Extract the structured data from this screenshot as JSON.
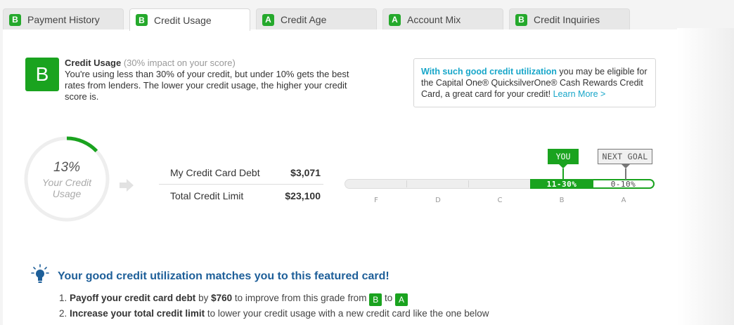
{
  "tabs": [
    {
      "grade": "B",
      "label": "Payment History"
    },
    {
      "grade": "B",
      "label": "Credit Usage"
    },
    {
      "grade": "A",
      "label": "Credit Age"
    },
    {
      "grade": "A",
      "label": "Account Mix"
    },
    {
      "grade": "B",
      "label": "Credit Inquiries"
    }
  ],
  "active_tab": "Credit Usage",
  "summary": {
    "grade": "B",
    "title": "Credit Usage",
    "impact": "(30% impact on your score)",
    "body": "You're using less than 30% of your credit, but under 10% gets the best rates from lenders. The lower your credit usage, the higher your credit score is."
  },
  "promo": {
    "highlight": "With such good credit utilization",
    "text": " you may be eligible for the Capital One® QuicksilverOne® Cash Rewards Credit Card, a great card for your credit! ",
    "link": "Learn More >"
  },
  "usage": {
    "percent_label": "13%",
    "percent_value": 13,
    "label": "Your Credit Usage"
  },
  "debt": {
    "rows": [
      {
        "label": "My Credit Card Debt",
        "value": "$3,071"
      },
      {
        "label": "Total Credit Limit",
        "value": "$23,100"
      }
    ]
  },
  "scale": {
    "you_flag": "YOU",
    "goal_flag": "NEXT GOAL",
    "you_range": "11-30%",
    "goal_range": "0-10%",
    "grades": [
      "F",
      "D",
      "C",
      "B",
      "A"
    ]
  },
  "featured": {
    "title": "Your good credit utilization matches you to this featured card!",
    "step1_bold": "Payoff your credit card debt",
    "step1_mid": " by ",
    "step1_amount": "$760",
    "step1_rest": " to improve from this grade from ",
    "step1_from": "B",
    "step1_to_word": " to ",
    "step1_to": "A",
    "step2_bold": "Increase your total credit limit",
    "step2_rest": " to lower your credit usage with a new credit card like the one below"
  },
  "colors": {
    "grade_green": "#1aa31f",
    "accent_blue": "#17a6c9",
    "title_blue": "#1e5f99"
  }
}
